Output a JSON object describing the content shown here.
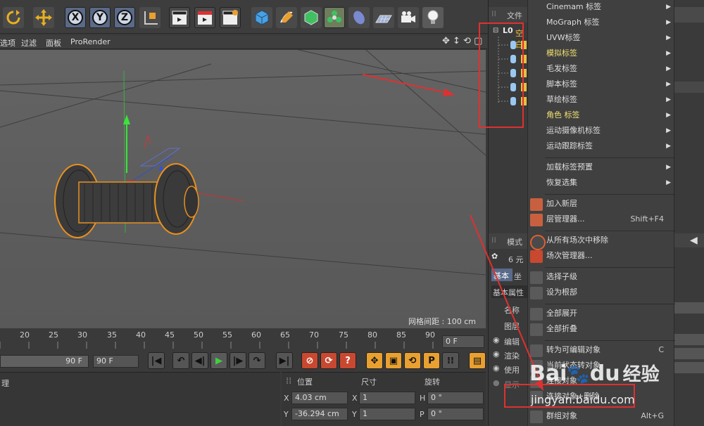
{
  "viewport_menu": {
    "items": [
      "选项",
      "过滤",
      "面板",
      "ProRender"
    ]
  },
  "viewport": {
    "grid_spacing": "网格间距 : 100 cm"
  },
  "timeline": {
    "ticks": [
      "20",
      "25",
      "30",
      "35",
      "40",
      "45",
      "50",
      "55",
      "60",
      "65",
      "70",
      "75",
      "80",
      "85",
      "90"
    ],
    "current_frame": "0 F",
    "end_frame_a": "90 F",
    "end_frame_b": "90 F"
  },
  "bottom_left": {
    "label": "理"
  },
  "coords": {
    "headers": {
      "position": "位置",
      "size": "尺寸",
      "rotation": "旋转"
    },
    "rows": [
      {
        "axis": "X",
        "position": "4.03 cm",
        "size_axis": "X",
        "size": "1",
        "rot_axis": "H",
        "rotation": "0 °"
      },
      {
        "axis": "Y",
        "position": "-36.294 cm",
        "size_axis": "Y",
        "size": "1",
        "rot_axis": "P",
        "rotation": "0 °"
      }
    ]
  },
  "object_panel": {
    "menu_file": "文件",
    "root_label": "空白"
  },
  "attr_panel": {
    "mode": "模式",
    "elements": "6 元",
    "tab_basic": "基本",
    "tab_coord": "坐",
    "section": "基本属性",
    "name_label": "名称",
    "layer_label": "图层",
    "editor_label": "编辑",
    "render_label": "渲染",
    "use_label": "使用",
    "display_label": "显示"
  },
  "context_menu": {
    "tag_items": [
      {
        "label": "Cinemam 标签",
        "submenu": true
      },
      {
        "label": "MoGraph 标签",
        "submenu": true
      },
      {
        "label": "UVW标签",
        "submenu": true
      },
      {
        "label": "模拟标签",
        "submenu": true,
        "highlight": true
      },
      {
        "label": "毛发标签",
        "submenu": true
      },
      {
        "label": "脚本标签",
        "submenu": true
      },
      {
        "label": "草绘标签",
        "submenu": true
      },
      {
        "label": "角色 标签",
        "submenu": true,
        "highlight": true
      },
      {
        "label": "运动摄像机标签",
        "submenu": true
      },
      {
        "label": "运动跟踪标签",
        "submenu": true
      }
    ],
    "preset_items": [
      {
        "label": "加载标签预置",
        "submenu": true
      },
      {
        "label": "恢复选集",
        "submenu": true
      }
    ],
    "layer_items": [
      {
        "label": "加入新层",
        "icon": "layer-add-icon"
      },
      {
        "label": "层管理器...",
        "shortcut": "Shift+F4",
        "icon": "layer-manager-icon"
      }
    ],
    "take_items": [
      {
        "label": "从所有场次中移除",
        "icon": "take-remove-icon"
      },
      {
        "label": "场次管理器...",
        "icon": "take-manager-icon"
      }
    ],
    "hierarchy_items": [
      {
        "label": "选择子级",
        "icon": "select-children-icon"
      },
      {
        "label": "设为根部",
        "icon": "set-root-icon"
      }
    ],
    "fold_items": [
      {
        "label": "全部展开",
        "icon": "expand-all-icon"
      },
      {
        "label": "全部折叠",
        "icon": "collapse-all-icon"
      }
    ],
    "convert_items": [
      {
        "label": "转为可编辑对象",
        "shortcut": "C",
        "icon": "make-editable-icon"
      },
      {
        "label": "当前状态转对象",
        "icon": "current-state-icon"
      },
      {
        "label": "连接对象",
        "icon": "connect-icon"
      },
      {
        "label": "连接对象+删除",
        "icon": "connect-delete-icon"
      },
      {
        "label": "群组对象",
        "shortcut": "Alt+G",
        "icon": "group-icon"
      }
    ]
  },
  "watermark": {
    "brand": "Bai",
    "brand2": "du",
    "brand_cn": "经验",
    "url": "jingyan.baidu.com"
  },
  "colors": {
    "accent_red": "#e03030",
    "highlight_text": "#f0e070",
    "object_orange": "#e89020"
  }
}
